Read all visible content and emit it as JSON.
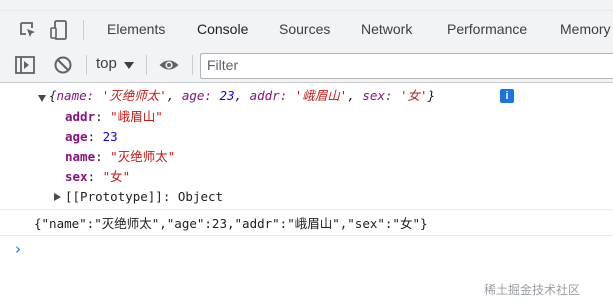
{
  "tabs": [
    {
      "label": "Elements"
    },
    {
      "label": "Console"
    },
    {
      "label": "Sources"
    },
    {
      "label": "Network"
    },
    {
      "label": "Performance"
    },
    {
      "label": "Memory"
    }
  ],
  "toolbar": {
    "context": "top",
    "filter_placeholder": "Filter"
  },
  "console": {
    "summary": {
      "open": "{",
      "k1": "name:",
      "v1": "'灭绝师太'",
      "s1": ",",
      "k2": "age:",
      "v2": "23",
      "s2": ",",
      "k3": "addr:",
      "v3": "'峨眉山'",
      "s3": ",",
      "k4": "sex:",
      "v4": "'女'",
      "close": "}"
    },
    "props": [
      {
        "key": "addr",
        "sep": ":",
        "value": "\"峨眉山\""
      },
      {
        "key": "age",
        "sep": ":",
        "value": "23"
      },
      {
        "key": "name",
        "sep": ":",
        "value": "\"灭绝师太\""
      },
      {
        "key": "sex",
        "sep": ":",
        "value": "\"女\""
      }
    ],
    "prototype": {
      "key": "[[Prototype]]",
      "sep": ":",
      "value": "Object"
    },
    "json_line": "{\"name\":\"灭绝师太\",\"age\":23,\"addr\":\"峨眉山\",\"sex\":\"女\"}",
    "info_badge": "i",
    "prompt_symbol": "›"
  },
  "watermark": "稀土掘金技术社区",
  "colors": {
    "accent": "#1a73e8",
    "key": "#881280",
    "string": "#c41a16",
    "number": "#1c00cf"
  }
}
